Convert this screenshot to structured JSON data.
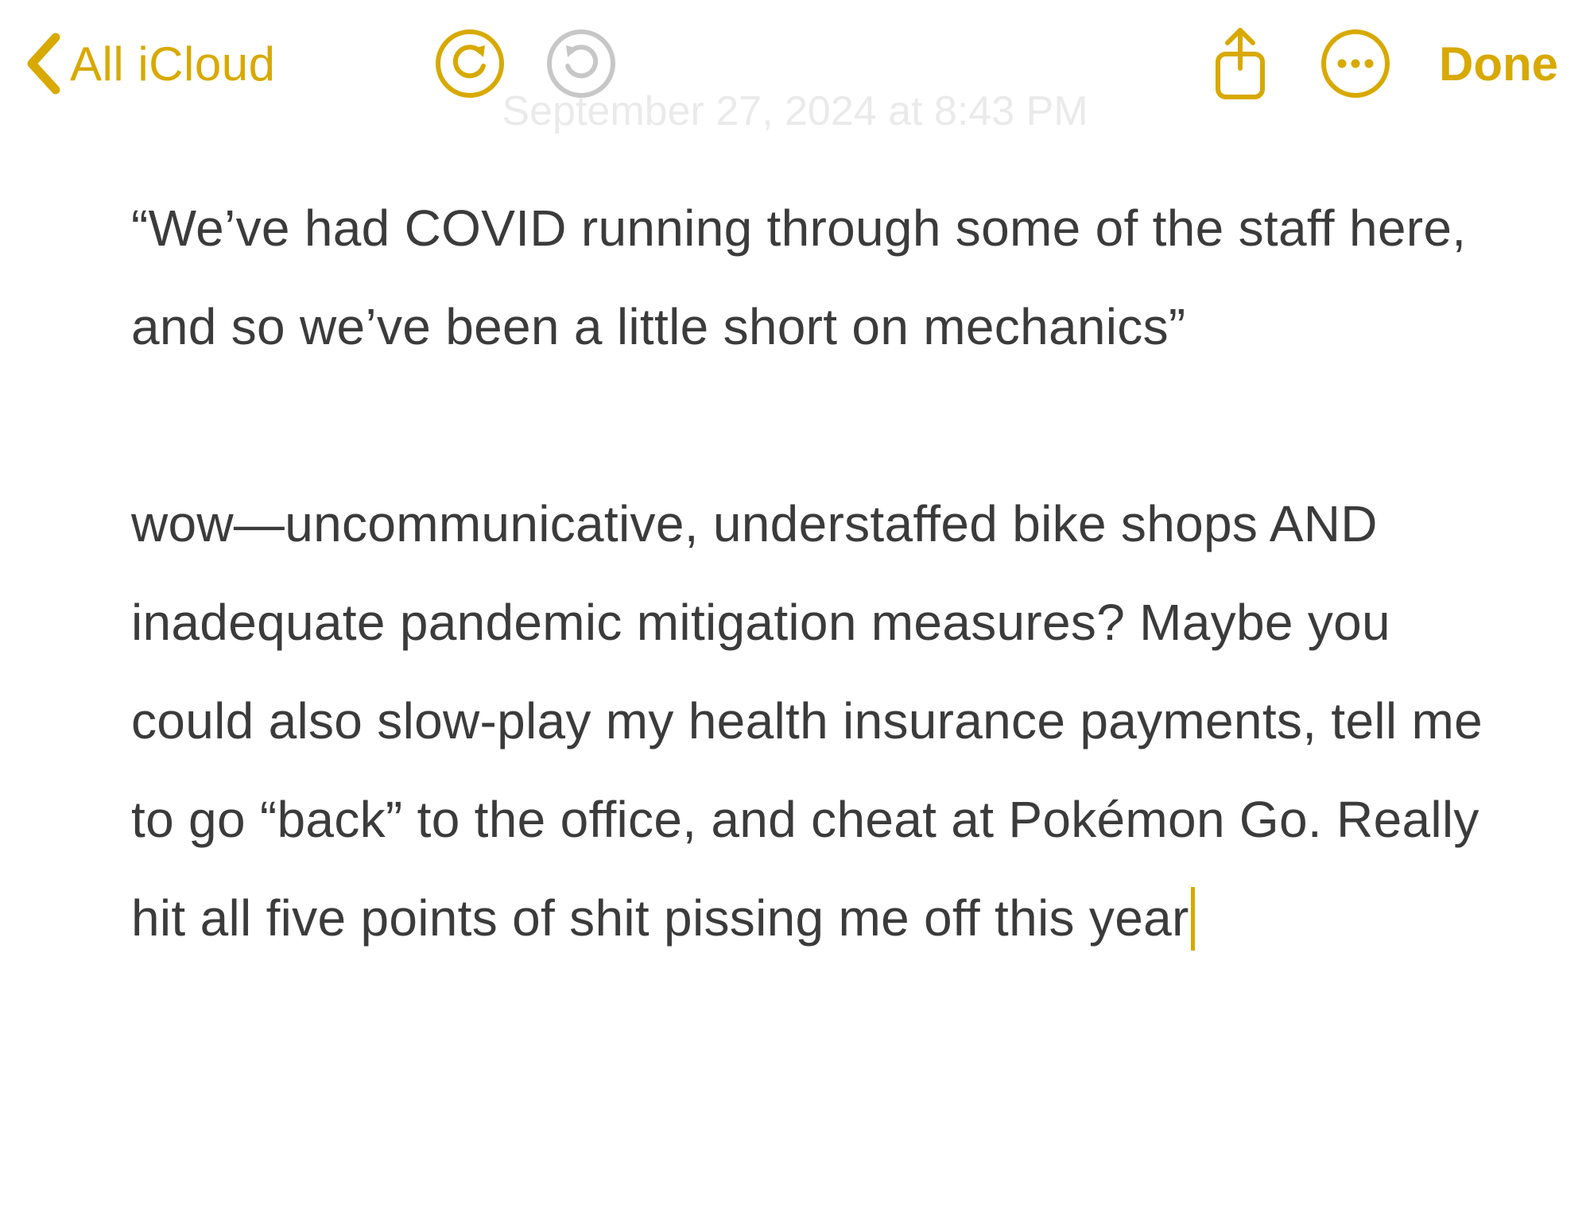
{
  "toolbar": {
    "back_label": "All iCloud",
    "done_label": "Done"
  },
  "note": {
    "timestamp": "September 27, 2024 at 8:43 PM",
    "body": "“We’ve had COVID running through some of the staff here, and so we’ve been a little short on mechanics”\n\nwow—uncommunicative, understaffed bike shops AND inadequate pandemic mitigation measures? Maybe you could also slow-play my health insurance payments, tell me to go “back” to the office, and cheat at Pokémon Go. Really hit all five points of shit pissing me off this year"
  },
  "colors": {
    "accent": "#d8a900",
    "text": "#3b3b3b",
    "disabled": "#c7c7c7"
  }
}
